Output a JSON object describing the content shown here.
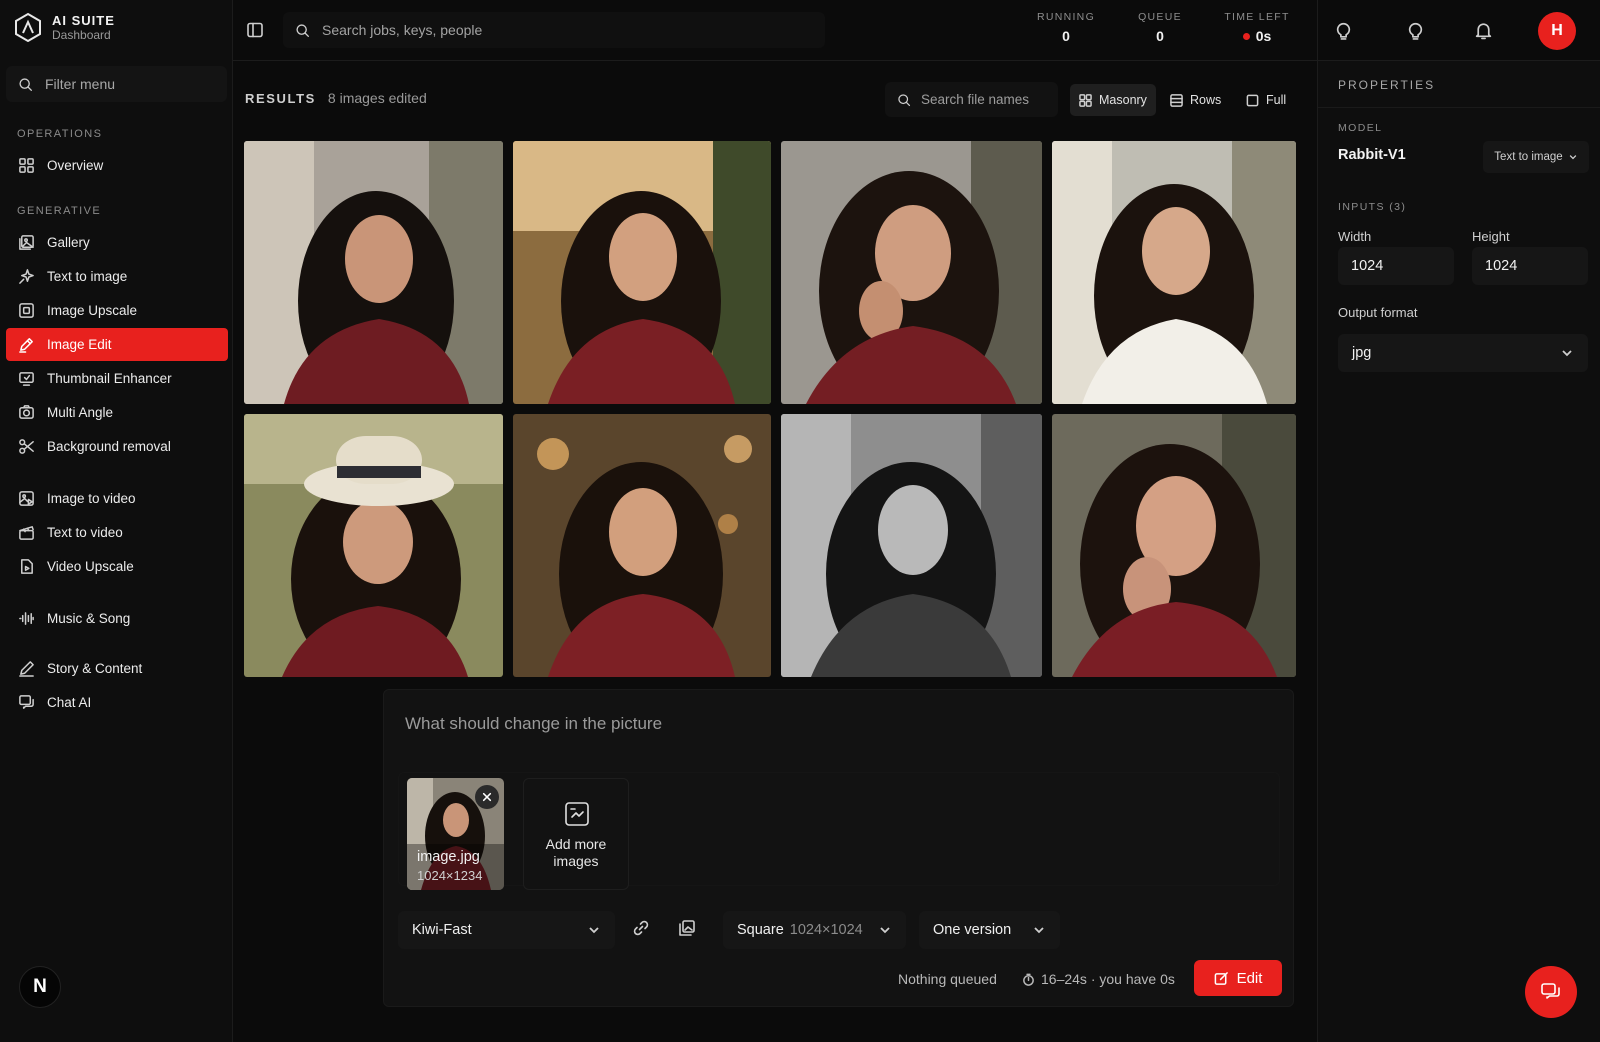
{
  "brand": {
    "title": "AI SUITE",
    "subtitle": "Dashboard"
  },
  "sidebar": {
    "filter_placeholder": "Filter menu",
    "section_operations": "OPERATIONS",
    "section_generative": "GENERATIVE",
    "items": [
      {
        "label": "Overview",
        "icon": "grid-icon"
      },
      {
        "label": "Gallery",
        "icon": "gallery-icon"
      },
      {
        "label": "Text to image",
        "icon": "sparkle-icon"
      },
      {
        "label": "Image Upscale",
        "icon": "upscale-icon"
      },
      {
        "label": "Image Edit",
        "icon": "pencil-icon",
        "active": true
      },
      {
        "label": "Thumbnail Enhancer",
        "icon": "monitor-icon"
      },
      {
        "label": "Multi Angle",
        "icon": "camera-icon"
      },
      {
        "label": "Background removal",
        "icon": "scissors-icon"
      },
      {
        "label": "Image to video",
        "icon": "image-video-icon"
      },
      {
        "label": "Text to video",
        "icon": "clapper-icon"
      },
      {
        "label": "Video Upscale",
        "icon": "video-file-icon"
      },
      {
        "label": "Music & Song",
        "icon": "waveform-icon"
      },
      {
        "label": "Story & Content",
        "icon": "pen-icon"
      },
      {
        "label": "Chat AI",
        "icon": "chat-icon"
      }
    ],
    "user_initial": "N"
  },
  "topbar": {
    "search_placeholder": "Search jobs, keys, people",
    "stats": [
      {
        "label": "RUNNING",
        "value": "0"
      },
      {
        "label": "QUEUE",
        "value": "0"
      },
      {
        "label": "TIME LEFT",
        "value": "0s"
      }
    ],
    "user_initial": "H"
  },
  "results": {
    "label": "RESULTS",
    "count": "8 images edited",
    "search_placeholder": "Search file names",
    "views": [
      {
        "label": "Masonry",
        "active": true
      },
      {
        "label": "Rows",
        "active": false
      },
      {
        "label": "Full",
        "active": false
      }
    ]
  },
  "composer": {
    "prompt_placeholder": "What should change in the picture",
    "attachment": {
      "name": "image.jpg",
      "size": "1024×1234"
    },
    "add_more": "Add more\nimages",
    "model": "Kiwi-Fast",
    "aspect": "Square",
    "aspect_dims": "1024×1024",
    "versions": "One version",
    "queue_status": "Nothing queued",
    "eta": "16–24s · you have 0s",
    "edit_label": "Edit"
  },
  "properties": {
    "title": "PROPERTIES",
    "model_label": "MODEL",
    "model_name": "Rabbit-V1",
    "model_type": "Text to image",
    "inputs_label": "INPUTS (3)",
    "width_label": "Width",
    "width_value": "1024",
    "height_label": "Height",
    "height_value": "1024",
    "format_label": "Output format",
    "format_value": "jpg"
  },
  "colors": {
    "accent": "#e8211e",
    "bg": "#0b0b0b",
    "panel": "#0e0e0e"
  }
}
